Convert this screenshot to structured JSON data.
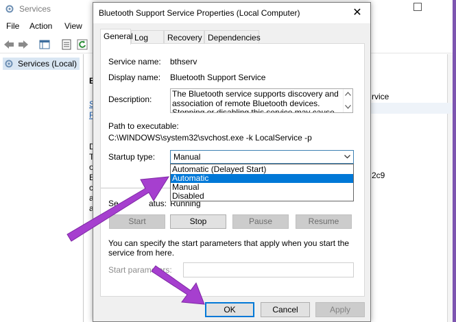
{
  "background_window": {
    "title": "Services",
    "menu": [
      "File",
      "Action",
      "View"
    ],
    "tree_root": "Services (Local)",
    "peek_texts": {
      "heading_b": "B",
      "rvice": "rvice",
      "c9": "2c9",
      "links": [
        "S",
        "R"
      ],
      "letters": [
        "D",
        "T",
        "o",
        "E",
        "c",
        "a",
        "a"
      ]
    }
  },
  "dialog": {
    "title": "Bluetooth Support Service Properties (Local Computer)",
    "close_glyph": "✕",
    "tabs": [
      "General",
      "Log On",
      "Recovery",
      "Dependencies"
    ],
    "active_tab": "General",
    "fields": {
      "service_name_label": "Service name:",
      "service_name_value": "bthserv",
      "display_name_label": "Display name:",
      "display_name_value": "Bluetooth Support Service",
      "description_label": "Description:",
      "description_value": "The Bluetooth service supports discovery and association of remote Bluetooth devices.  Stopping or disabling this service may cause already installed",
      "path_label": "Path to executable:",
      "path_value": "C:\\WINDOWS\\system32\\svchost.exe -k LocalService -p",
      "startup_type_label": "Startup type:",
      "startup_type_value": "Manual",
      "startup_options": [
        "Automatic (Delayed Start)",
        "Automatic",
        "Manual",
        "Disabled"
      ],
      "startup_highlighted": "Automatic",
      "service_status_label_partial": "Se",
      "service_status_label_tail": "atus:",
      "service_status_value": "Running"
    },
    "service_buttons": {
      "start": "Start",
      "stop": "Stop",
      "pause": "Pause",
      "resume": "Resume"
    },
    "params_hint": "You can specify the start parameters that apply when you start the service from here.",
    "params_label": "Start parameters:",
    "params_value": "",
    "footer_buttons": {
      "ok": "OK",
      "cancel": "Cancel",
      "apply": "Apply"
    }
  },
  "colors": {
    "accent_blue": "#0078d7",
    "annotation_arrow": "#a63fcf",
    "dialog_bg": "#f0f0f0"
  }
}
